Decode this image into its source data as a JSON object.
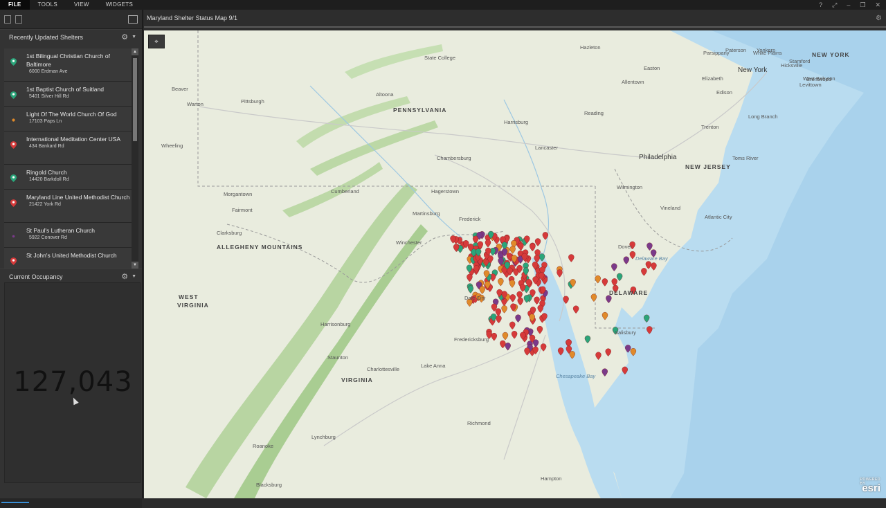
{
  "menubar": {
    "items": [
      "FILE",
      "TOOLS",
      "VIEW",
      "WIDGETS"
    ]
  },
  "shelters": {
    "title": "Recently Updated Shelters",
    "items": [
      {
        "name": "1st Bilingual Christian Church of Baltimore",
        "address": "6000 Erdman Ave",
        "color": "#2aa57a"
      },
      {
        "name": "1st Baptist Church of Suitland",
        "address": "5401 Silver Hill Rd",
        "color": "#2aa57a"
      },
      {
        "name": "Light Of The World Church Of God",
        "address": "17103 Paps Ln",
        "color": "#e08a2a"
      },
      {
        "name": "International Meditation Center USA",
        "address": "434 Bankard Rd",
        "color": "#d63a3a"
      },
      {
        "name": "Ringold Church",
        "address": "14420 Barkdoll Rd",
        "color": "#2aa57a"
      },
      {
        "name": "Maryland Line United Methodist Church",
        "address": "21422 York Rd",
        "color": "#d63a3a"
      },
      {
        "name": "St Paul's Lutheran Church",
        "address": "5922 Conover Rd",
        "color": "#7a3a8a"
      },
      {
        "name": "St John's United Methodist Church",
        "address": "",
        "color": "#d63a3a"
      }
    ]
  },
  "occupancy": {
    "title": "Current Occupancy",
    "value": "127,043"
  },
  "map": {
    "title": "Maryland Shelter Status Map 9/1",
    "brand": "esri",
    "brand_small": "POWERED BY",
    "labels": [
      {
        "text": "PENNSYLVANIA",
        "kind": "state"
      },
      {
        "text": "WEST",
        "kind": "state"
      },
      {
        "text": "VIRGINIA",
        "kind": "state"
      },
      {
        "text": "VIRGINIA",
        "kind": "state"
      },
      {
        "text": "NEW JERSEY",
        "kind": "state"
      },
      {
        "text": "DELAWARE",
        "kind": "state"
      },
      {
        "text": "NEW YORK",
        "kind": "state"
      },
      {
        "text": "ALLEGHENY MOUNTAINS",
        "kind": "state"
      },
      {
        "text": "Philadelphia",
        "kind": "big"
      },
      {
        "text": "New York",
        "kind": "big"
      },
      {
        "text": "Pittsburgh",
        "kind": "city"
      },
      {
        "text": "State College",
        "kind": "city"
      },
      {
        "text": "Altoona",
        "kind": "city"
      },
      {
        "text": "Harrisburg",
        "kind": "city"
      },
      {
        "text": "Lancaster",
        "kind": "city"
      },
      {
        "text": "Reading",
        "kind": "city"
      },
      {
        "text": "Allentown",
        "kind": "city"
      },
      {
        "text": "Trenton",
        "kind": "city"
      },
      {
        "text": "Hazleton",
        "kind": "city"
      },
      {
        "text": "Wheeling",
        "kind": "city"
      },
      {
        "text": "Morgantown",
        "kind": "city"
      },
      {
        "text": "Cumberland",
        "kind": "city"
      },
      {
        "text": "Hagerstown",
        "kind": "city"
      },
      {
        "text": "Chambersburg",
        "kind": "city"
      },
      {
        "text": "Martinsburg",
        "kind": "city"
      },
      {
        "text": "Winchester",
        "kind": "city"
      },
      {
        "text": "Frederick",
        "kind": "city"
      },
      {
        "text": "Fairmont",
        "kind": "city"
      },
      {
        "text": "Clarksburg",
        "kind": "city"
      },
      {
        "text": "Harrisonburg",
        "kind": "city"
      },
      {
        "text": "Staunton",
        "kind": "city"
      },
      {
        "text": "Charlottesville",
        "kind": "city"
      },
      {
        "text": "Fredericksburg",
        "kind": "city"
      },
      {
        "text": "Richmond",
        "kind": "city"
      },
      {
        "text": "Lynchburg",
        "kind": "city"
      },
      {
        "text": "Roanoke",
        "kind": "city"
      },
      {
        "text": "Blacksburg",
        "kind": "city"
      },
      {
        "text": "Hampton",
        "kind": "city"
      },
      {
        "text": "Dover",
        "kind": "city"
      },
      {
        "text": "Vineland",
        "kind": "city"
      },
      {
        "text": "Wilmington",
        "kind": "city"
      },
      {
        "text": "Atlantic City",
        "kind": "city"
      },
      {
        "text": "Salisbury",
        "kind": "city"
      },
      {
        "text": "Toms River",
        "kind": "city"
      },
      {
        "text": "Long Branch",
        "kind": "city"
      },
      {
        "text": "Elizabeth",
        "kind": "city"
      },
      {
        "text": "Paterson",
        "kind": "city"
      },
      {
        "text": "Yonkers",
        "kind": "city"
      },
      {
        "text": "Stamford",
        "kind": "city"
      },
      {
        "text": "Hicksville",
        "kind": "city"
      },
      {
        "text": "Levittown",
        "kind": "city"
      },
      {
        "text": "Brentwood",
        "kind": "city"
      },
      {
        "text": "West Babyton",
        "kind": "city"
      },
      {
        "text": "Edison",
        "kind": "city"
      },
      {
        "text": "Parsippany",
        "kind": "city"
      },
      {
        "text": "White Plains",
        "kind": "city"
      },
      {
        "text": "Easton",
        "kind": "city"
      },
      {
        "text": "Dale City",
        "kind": "city"
      },
      {
        "text": "Lake Anna",
        "kind": "city"
      },
      {
        "text": "Chesapeake Bay",
        "kind": "water"
      },
      {
        "text": "Delaware Bay",
        "kind": "water"
      },
      {
        "text": "Warton",
        "kind": "city"
      },
      {
        "text": "Beaver",
        "kind": "city"
      }
    ]
  }
}
